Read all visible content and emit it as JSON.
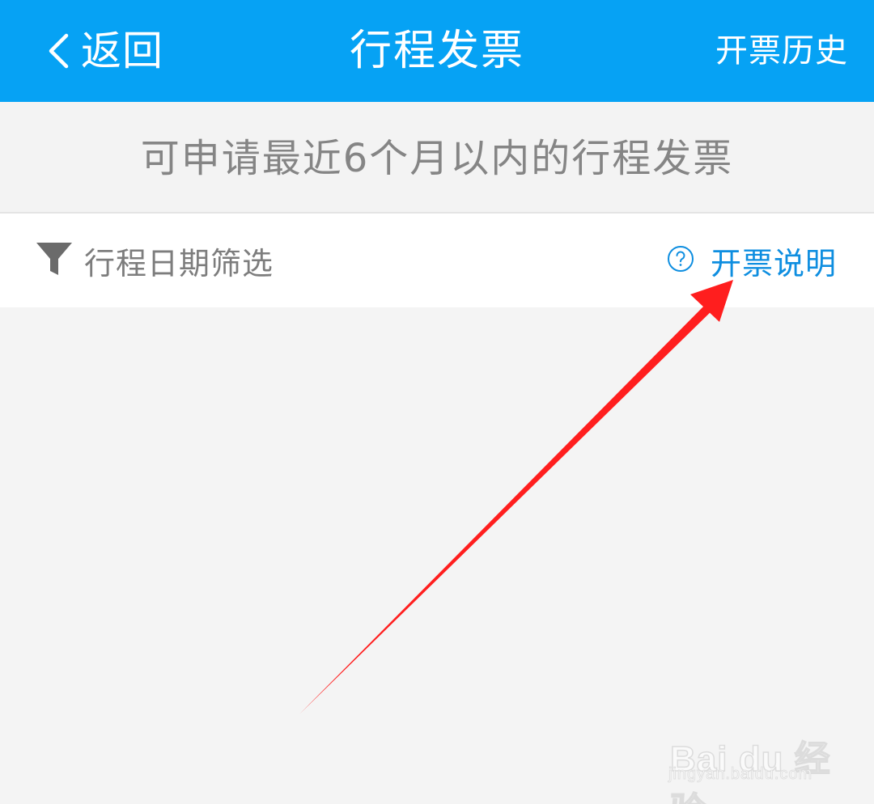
{
  "header": {
    "back_label": "返回",
    "title": "行程发票",
    "history_label": "开票历史",
    "background_color": "#06a2f4"
  },
  "notice": {
    "text": "可申请最近6个月以内的行程发票"
  },
  "filter": {
    "label": "行程日期筛选",
    "icon": "filter-icon"
  },
  "help": {
    "label": "开票说明",
    "icon": "question-circle-icon",
    "accent_color": "#0e8ee0"
  },
  "annotation": {
    "arrow_color": "#ff1e1e"
  },
  "watermark": {
    "brand": "Bai du 经验",
    "url": "jingyan.baidu.com"
  }
}
